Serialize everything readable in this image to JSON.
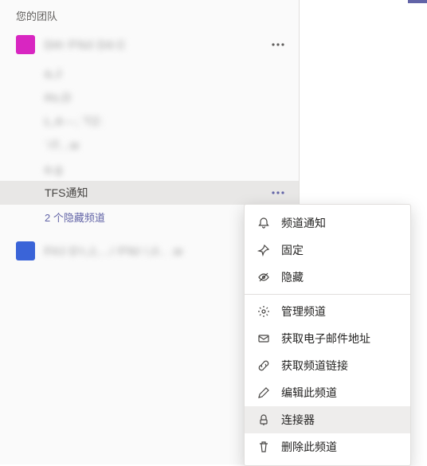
{
  "section_header": "您的团队",
  "teams": [
    {
      "avatar_letter": "",
      "avatar_color": "magenta",
      "name_obscured": "D#r  F%il D4:C",
      "channels_obscured": [
        "a,J",
        "#o,D",
        "L,4---,`TZ:",
        "`iT...w",
        "a.g"
      ],
      "selected_channel": "TFS通知",
      "hidden_channels_label": "2 个隐藏频道"
    },
    {
      "avatar_letter": "",
      "avatar_color": "blue",
      "name_obscured": "F#J   D'r,J,.../ F%l !,il.. .w"
    }
  ],
  "context_menu": {
    "items": [
      {
        "icon": "bell",
        "label": "频道通知"
      },
      {
        "icon": "pin",
        "label": "固定"
      },
      {
        "icon": "hide",
        "label": "隐藏"
      }
    ],
    "items2": [
      {
        "icon": "gear",
        "label": "管理频道"
      },
      {
        "icon": "mail",
        "label": "获取电子邮件地址"
      },
      {
        "icon": "link",
        "label": "获取频道链接"
      },
      {
        "icon": "pencil",
        "label": "编辑此频道"
      },
      {
        "icon": "connector",
        "label": "连接器",
        "highlighted": true
      },
      {
        "icon": "trash",
        "label": "删除此频道"
      }
    ]
  }
}
